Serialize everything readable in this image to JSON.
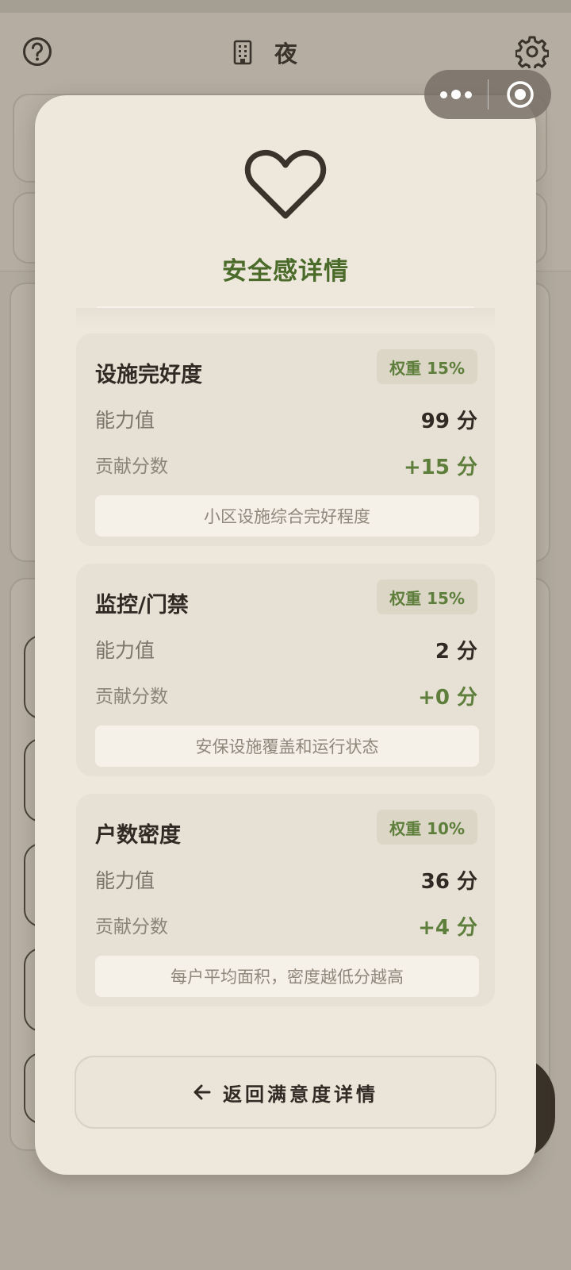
{
  "header": {
    "title": "夜",
    "help_icon": "help-circle-icon",
    "building_icon": "building-icon",
    "settings_icon": "gear-icon"
  },
  "capsule": {
    "more_icon": "more-dots-icon",
    "close_icon": "target-circle-icon"
  },
  "modal": {
    "icon": "heart-icon",
    "title": "安全感详情",
    "metrics": [
      {
        "name": "设施完好度",
        "weight": "权重 15%",
        "ability_label": "能力值",
        "ability_value": "99 分",
        "contrib_label": "贡献分数",
        "contrib_value": "+15 分",
        "description": "小区设施综合完好程度"
      },
      {
        "name": "监控/门禁",
        "weight": "权重 15%",
        "ability_label": "能力值",
        "ability_value": "2 分",
        "contrib_label": "贡献分数",
        "contrib_value": "+0 分",
        "description": "安保设施覆盖和运行状态"
      },
      {
        "name": "户数密度",
        "weight": "权重 10%",
        "ability_label": "能力值",
        "ability_value": "36 分",
        "contrib_label": "贡献分数",
        "contrib_value": "+4 分",
        "description": "每户平均面积，密度越低分越高"
      }
    ],
    "back_button_label": "返回满意度详情",
    "back_icon": "arrow-left-icon"
  },
  "colors": {
    "accent_green": "#4a6b2a",
    "weight_green": "#5e7e3c",
    "modal_bg": "#eee7dc",
    "card_bg": "#e7e0d4"
  }
}
